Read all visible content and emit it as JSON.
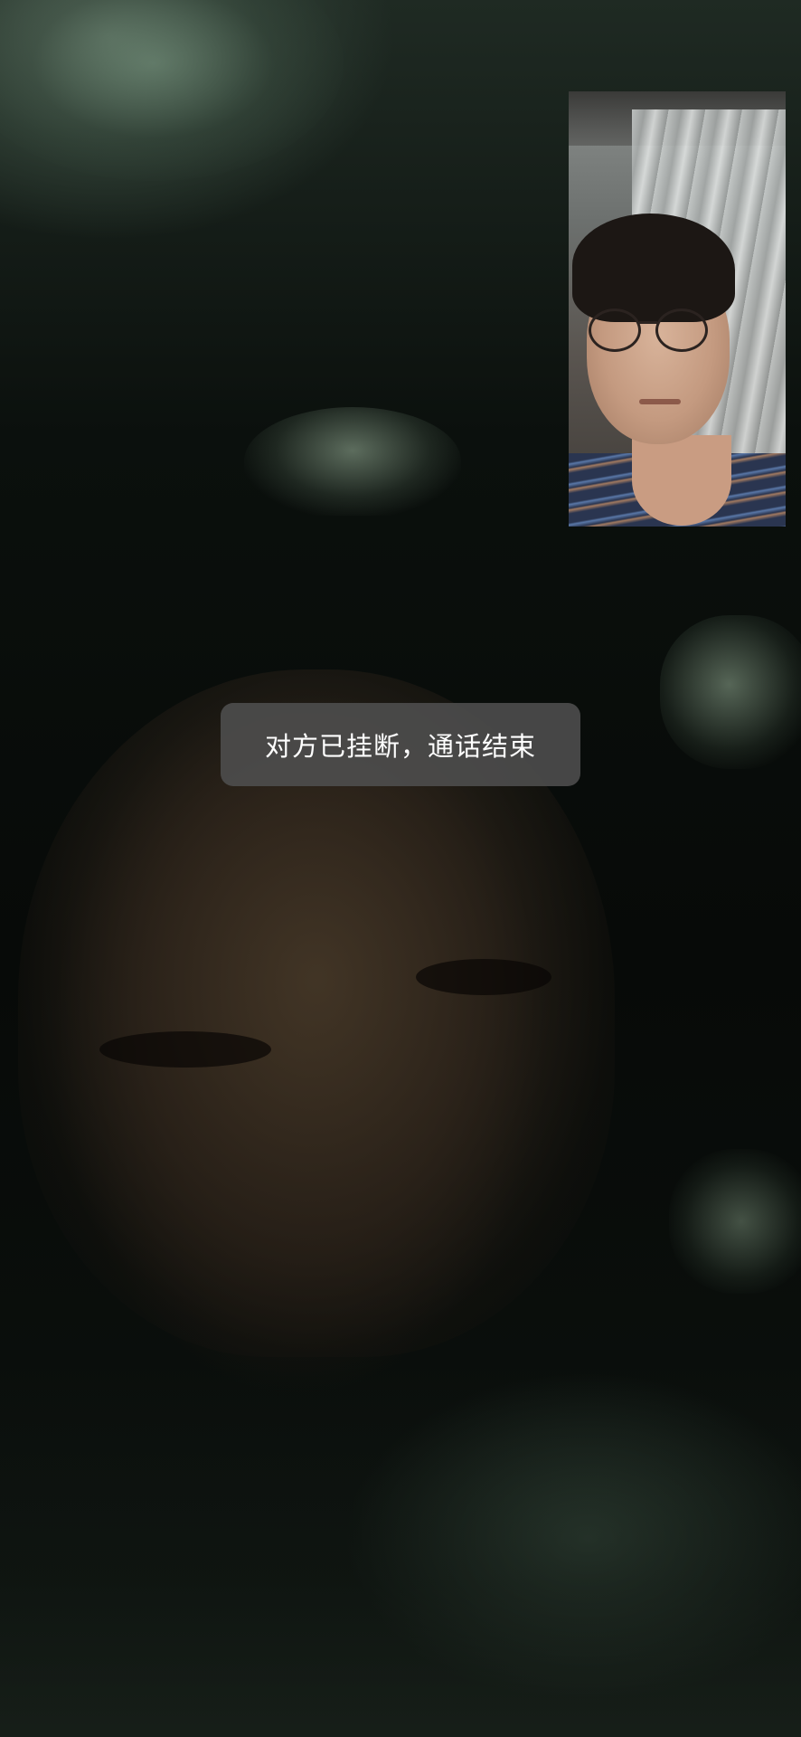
{
  "call": {
    "status_message": "对方已挂断，通话结束"
  },
  "colors": {
    "toast_background": "#4e4e4e",
    "toast_text": "#ffffff",
    "background": "#070a08"
  },
  "icons": []
}
